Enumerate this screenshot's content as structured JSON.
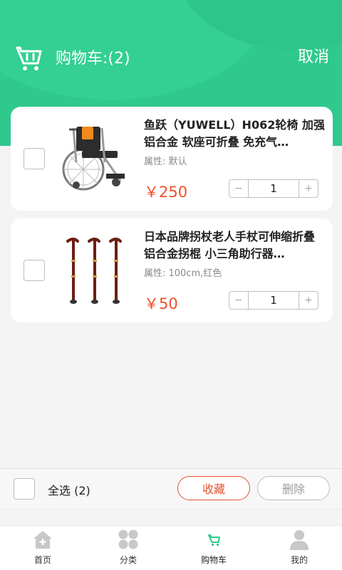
{
  "header": {
    "title": "购物车:(2)",
    "cancel_label": "取消",
    "accent_color": "#2fc88d"
  },
  "items": [
    {
      "name": "鱼跃（YUWELL）H062轮椅 加强铝合金 软座可折叠 免充气…",
      "attr": "属性:  默认",
      "price": "￥250",
      "quantity": "1",
      "checked": false,
      "image": "wheelchair"
    },
    {
      "name": "日本品牌拐杖老人手杖可伸缩折叠铝合金拐棍 小三角助行器…",
      "attr": "属性:  100cm,红色",
      "price": "￥50",
      "quantity": "1",
      "checked": false,
      "image": "walking-canes"
    }
  ],
  "stepper": {
    "minus": "−",
    "plus": "+"
  },
  "bottom_bar": {
    "select_all_label": "全选 (2)",
    "favorite_label": "收藏",
    "delete_label": "删除"
  },
  "tabbar": {
    "tabs": [
      {
        "label": "首页",
        "icon": "home-icon"
      },
      {
        "label": "分类",
        "icon": "category-icon"
      },
      {
        "label": "购物车",
        "icon": "cart-icon",
        "active": true
      },
      {
        "label": "我的",
        "icon": "profile-icon"
      }
    ]
  }
}
